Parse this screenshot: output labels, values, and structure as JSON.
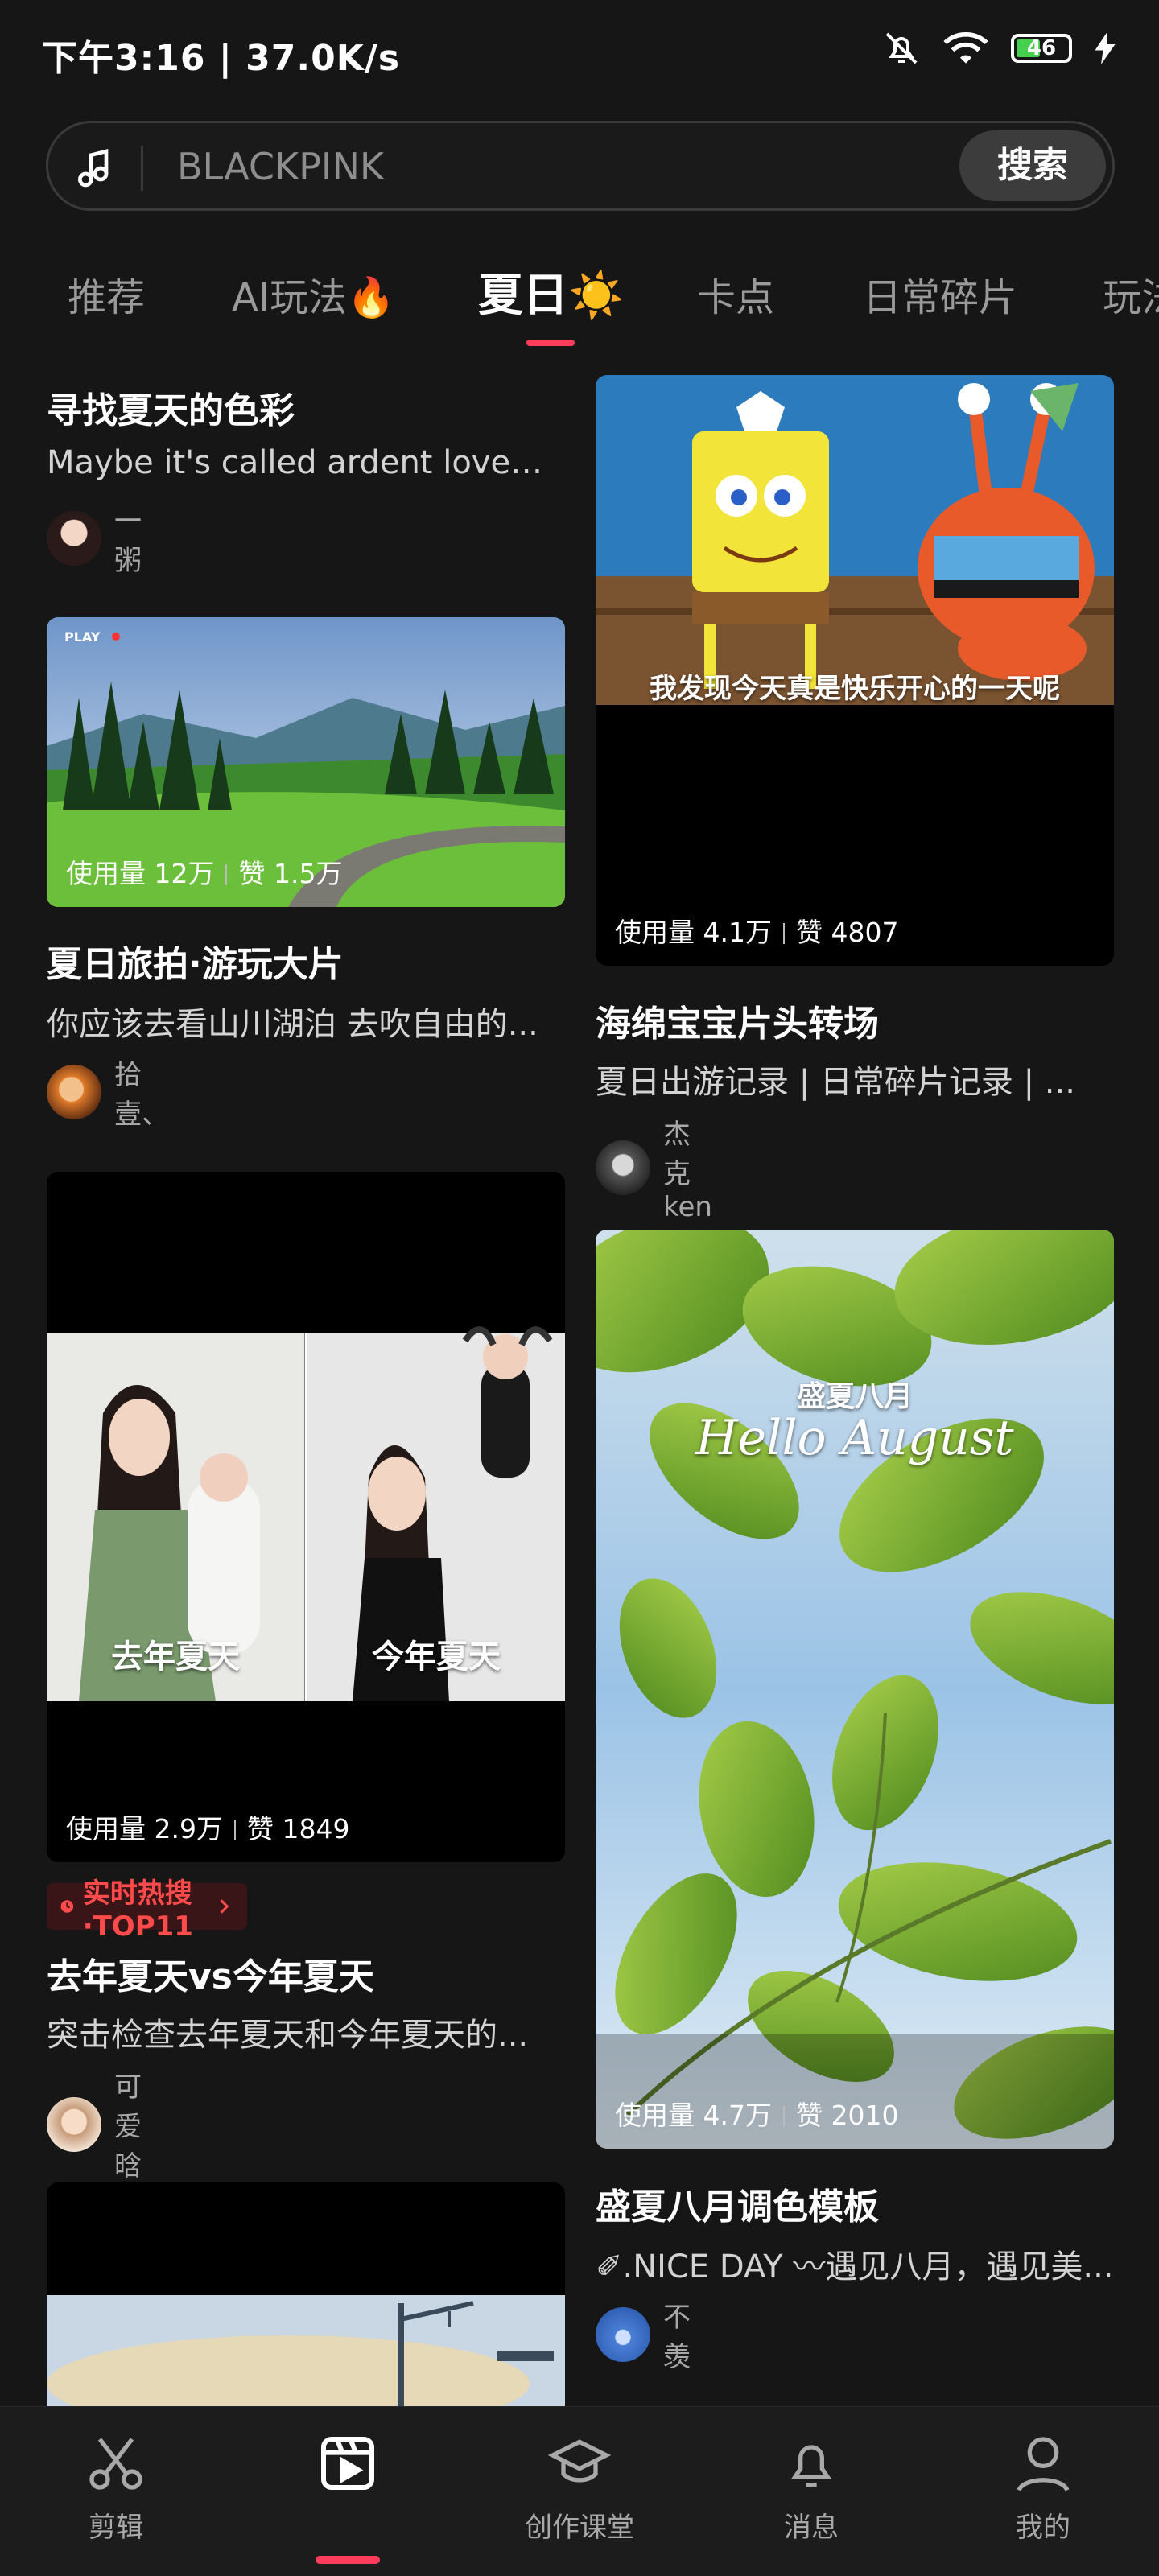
{
  "status": {
    "time": "下午3:16 | 37.0K/s",
    "battery": "46"
  },
  "search": {
    "placeholder": "BLACKPINK",
    "button": "搜索"
  },
  "tabs": [
    "推荐",
    "AI玩法🔥",
    "夏日☀️",
    "卡点",
    "日常碎片",
    "玩法"
  ],
  "active_tab": "夏日☀️",
  "cards": {
    "c1": {
      "title": "寻找夏天的色彩",
      "desc": "Maybe it's called ardent love#...",
      "author": "一粥"
    },
    "c2": {
      "stats_usage": "使用量 12万",
      "stats_likes": "赞 1.5万",
      "title": "夏日旅拍·游玩大片",
      "desc": "你应该去看山川湖泊 去吹自由的...",
      "author": "拾壹、",
      "overlay_brand": "PLAY"
    },
    "c3": {
      "caption": "我发现今天真是快乐开心的一天呢",
      "stats_usage": "使用量 4.1万",
      "stats_likes": "赞 4807",
      "title": "海绵宝宝片头转场",
      "desc": "夏日出游记录 | 日常碎片记录 | ...",
      "author": "杰克ken"
    },
    "c4": {
      "left_caption": "去年夏天",
      "right_caption": "今年夏天",
      "stats_usage": "使用量 2.9万",
      "stats_likes": "赞 1849",
      "hot": "实时热搜·TOP11",
      "title": "去年夏天vs今年夏天",
      "desc": "突击检查去年夏天和今年夏天的...",
      "author": "可爱晗"
    },
    "c5": {
      "cn_title": "盛夏八月",
      "en_title": "Hello August",
      "stats_usage": "使用量 4.7万",
      "stats_likes": "赞 2010",
      "title": "盛夏八月调色模板",
      "desc": "✐.NICE DAY 〰遇见八月，遇见美...",
      "author": "不羡"
    }
  },
  "nav": [
    {
      "label": "剪辑",
      "icon": "scissors-icon"
    },
    {
      "label": "",
      "icon": "template-icon"
    },
    {
      "label": "创作课堂",
      "icon": "graduation-cap-icon"
    },
    {
      "label": "消息",
      "icon": "bell-icon"
    },
    {
      "label": "我的",
      "icon": "person-icon"
    }
  ],
  "colors": {
    "background": "#161616",
    "accent": "#ff3c5c",
    "hot_text": "#ff4b4b"
  }
}
